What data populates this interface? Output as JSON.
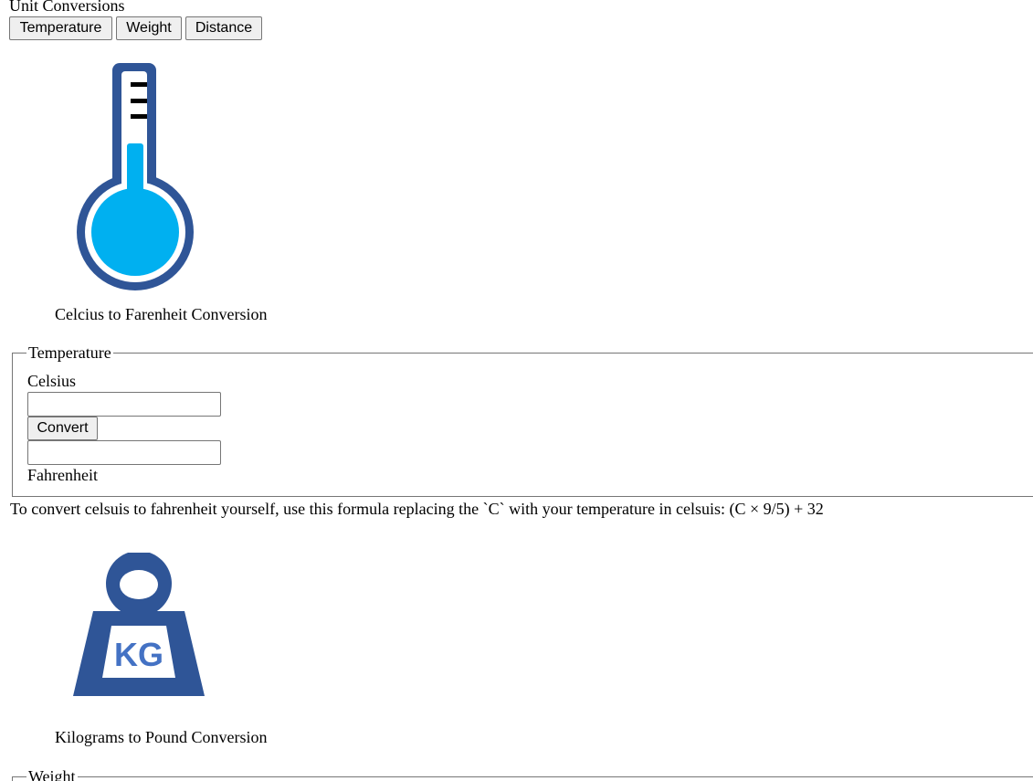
{
  "app": {
    "title": "Unit Conversions"
  },
  "nav": {
    "buttons": [
      {
        "label": "Temperature"
      },
      {
        "label": "Weight"
      },
      {
        "label": "Distance"
      }
    ]
  },
  "temperature": {
    "icon": "thermometer-icon",
    "caption": "Celcius to Farenheit Conversion",
    "legend": "Temperature",
    "input_label": "Celsius",
    "input_value": "",
    "convert_label": "Convert",
    "output_value": "",
    "output_label": "Fahrenheit",
    "formula": "To convert celsuis to fahrenheit yourself, use this formula replacing the `C` with your temperature in celsuis: (C × 9/5) + 32"
  },
  "weight": {
    "icon": "weight-kg-icon",
    "icon_text": "KG",
    "caption": "Kilograms to Pound Conversion",
    "legend": "Weight"
  },
  "colors": {
    "icon_dark_blue": "#2f5597",
    "thermo_fill": "#00b0f0",
    "kg_text": "#4472c4"
  }
}
